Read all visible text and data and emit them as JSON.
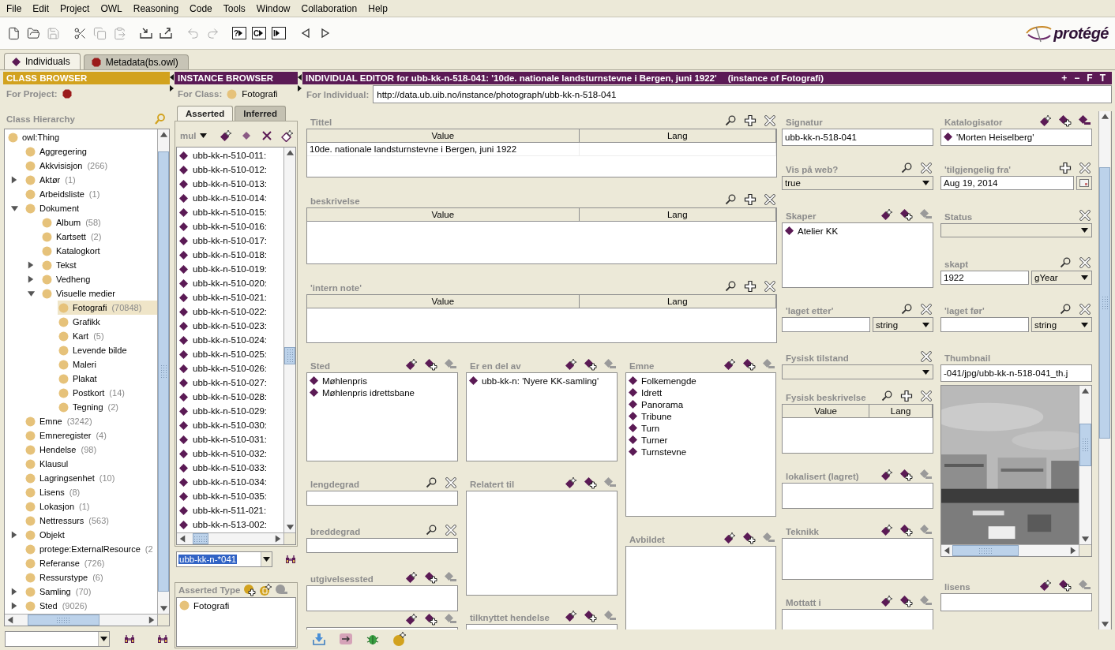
{
  "menu": [
    "File",
    "Edit",
    "Project",
    "OWL",
    "Reasoning",
    "Code",
    "Tools",
    "Window",
    "Collaboration",
    "Help"
  ],
  "toolbar": [
    [
      {
        "kind": "new",
        "disabled": false
      },
      {
        "kind": "open",
        "disabled": false
      },
      {
        "kind": "save",
        "disabled": true
      }
    ],
    [
      {
        "kind": "cut",
        "disabled": false
      },
      {
        "kind": "copy",
        "disabled": true
      },
      {
        "kind": "paste",
        "disabled": true
      }
    ],
    [
      {
        "kind": "import",
        "disabled": false
      },
      {
        "kind": "export",
        "disabled": false
      }
    ],
    [
      {
        "kind": "undo",
        "disabled": true
      },
      {
        "kind": "redo",
        "disabled": true
      }
    ],
    [
      {
        "kind": "query",
        "label": "?",
        "disabled": false
      },
      {
        "kind": "query",
        "label": "C",
        "disabled": false
      },
      {
        "kind": "query",
        "label": "I",
        "disabled": false
      }
    ],
    [
      {
        "kind": "back",
        "disabled": false
      },
      {
        "kind": "forward",
        "disabled": false
      }
    ]
  ],
  "logo": "protégé",
  "tabs": [
    {
      "label": "Individuals",
      "kind": "individual",
      "selected": true
    },
    {
      "label": "Metadata(bs.owl)",
      "kind": "ontology",
      "selected": false
    }
  ],
  "class_browser": {
    "title": "CLASS BROWSER",
    "project_label": "For Project:",
    "hierarchy_label": "Class Hierarchy",
    "tree": [
      {
        "name": "owl:Thing",
        "selected": false,
        "children": [
          {
            "name": "Aggregering",
            "selected": false
          },
          {
            "name": "Akkvisisjon",
            "count": "(266)",
            "selected": false
          },
          {
            "name": "Aktør",
            "count": "(1)",
            "selected": false,
            "expanded": false
          },
          {
            "name": "Arbeidsliste",
            "count": "(1)",
            "selected": false
          },
          {
            "name": "Dokument",
            "selected": false,
            "expanded": true,
            "children": [
              {
                "name": "Album",
                "count": "(58)",
                "selected": false
              },
              {
                "name": "Kartsett",
                "count": "(2)",
                "selected": false
              },
              {
                "name": "Katalogkort",
                "selected": false
              },
              {
                "name": "Tekst",
                "selected": false,
                "expanded": false
              },
              {
                "name": "Vedheng",
                "selected": false,
                "expanded": false
              },
              {
                "name": "Visuelle medier",
                "selected": false,
                "expanded": true,
                "children": [
                  {
                    "name": "Fotografi",
                    "count": "(70848)",
                    "selected": true
                  },
                  {
                    "name": "Grafikk",
                    "selected": false
                  },
                  {
                    "name": "Kart",
                    "count": "(5)",
                    "selected": false
                  },
                  {
                    "name": "Levende bilde",
                    "selected": false
                  },
                  {
                    "name": "Maleri",
                    "selected": false
                  },
                  {
                    "name": "Plakat",
                    "selected": false
                  },
                  {
                    "name": "Postkort",
                    "count": "(14)",
                    "selected": false
                  },
                  {
                    "name": "Tegning",
                    "count": "(2)",
                    "selected": false
                  }
                ]
              }
            ]
          },
          {
            "name": "Emne",
            "count": "(3242)",
            "selected": false
          },
          {
            "name": "Emneregister",
            "count": "(4)",
            "selected": false
          },
          {
            "name": "Hendelse",
            "count": "(98)",
            "selected": false
          },
          {
            "name": "Klausul",
            "selected": false
          },
          {
            "name": "Lagringsenhet",
            "count": "(10)",
            "selected": false
          },
          {
            "name": "Lisens",
            "count": "(8)",
            "selected": false
          },
          {
            "name": "Lokasjon",
            "count": "(1)",
            "selected": false
          },
          {
            "name": "Nettressurs",
            "count": "(563)",
            "selected": false
          },
          {
            "name": "Objekt",
            "selected": false,
            "expanded": false
          },
          {
            "name": "protege:ExternalResource",
            "count": "(2",
            "selected": false
          },
          {
            "name": "Referanse",
            "count": "(726)",
            "selected": false
          },
          {
            "name": "Ressurstype",
            "count": "(6)",
            "selected": false
          },
          {
            "name": "Samling",
            "count": "(70)",
            "selected": false,
            "expanded": false
          },
          {
            "name": "Sted",
            "count": "(9026)",
            "selected": false,
            "expanded": false
          }
        ]
      }
    ]
  },
  "instance_browser": {
    "title": "INSTANCE BROWSER",
    "class_label": "For Class:",
    "class_name": "Fotografi",
    "tabs": [
      {
        "label": "Asserted",
        "selected": true
      },
      {
        "label": "Inferred",
        "selected": false
      }
    ],
    "filter": "mul",
    "tools": [
      {
        "kind": "create"
      },
      {
        "kind": "copy"
      },
      {
        "kind": "delete"
      },
      {
        "kind": "edit"
      }
    ],
    "instances": [
      {
        "name": "ubb-kk-n-510-011:",
        "selected": false
      },
      {
        "name": "ubb-kk-n-510-012:",
        "selected": false
      },
      {
        "name": "ubb-kk-n-510-013:",
        "selected": false
      },
      {
        "name": "ubb-kk-n-510-014:",
        "selected": false
      },
      {
        "name": "ubb-kk-n-510-015:",
        "selected": false
      },
      {
        "name": "ubb-kk-n-510-016:",
        "selected": false
      },
      {
        "name": "ubb-kk-n-510-017:",
        "selected": false
      },
      {
        "name": "ubb-kk-n-510-018:",
        "selected": false
      },
      {
        "name": "ubb-kk-n-510-019:",
        "selected": false
      },
      {
        "name": "ubb-kk-n-510-020:",
        "selected": false
      },
      {
        "name": "ubb-kk-n-510-021:",
        "selected": false
      },
      {
        "name": "ubb-kk-n-510-022:",
        "selected": false
      },
      {
        "name": "ubb-kk-n-510-023:",
        "selected": false
      },
      {
        "name": "ubb-kk-n-510-024:",
        "selected": false
      },
      {
        "name": "ubb-kk-n-510-025:",
        "selected": false
      },
      {
        "name": "ubb-kk-n-510-026:",
        "selected": false
      },
      {
        "name": "ubb-kk-n-510-027:",
        "selected": false
      },
      {
        "name": "ubb-kk-n-510-028:",
        "selected": false
      },
      {
        "name": "ubb-kk-n-510-029:",
        "selected": false
      },
      {
        "name": "ubb-kk-n-510-030:",
        "selected": false
      },
      {
        "name": "ubb-kk-n-510-031:",
        "selected": false
      },
      {
        "name": "ubb-kk-n-510-032:",
        "selected": false
      },
      {
        "name": "ubb-kk-n-510-033:",
        "selected": false
      },
      {
        "name": "ubb-kk-n-510-034:",
        "selected": false
      },
      {
        "name": "ubb-kk-n-510-035:",
        "selected": false
      },
      {
        "name": "ubb-kk-n-511-021:",
        "selected": false
      },
      {
        "name": "ubb-kk-n-513-002:",
        "selected": false
      }
    ],
    "search": "ubb-kk-n-*041",
    "types_label": "Asserted Type",
    "types_tools": [
      {
        "kind": "add_class"
      },
      {
        "kind": "create_class"
      },
      {
        "kind": "remove_class"
      }
    ],
    "types": [
      "Fotografi"
    ]
  },
  "editor": {
    "title": "INDIVIDUAL EDITOR for ubb-kk-n-518-041: '10de. nationale landsturnstevne i Bergen, juni 1922'",
    "subtitle": "(instance of Fotografi)",
    "header_buttons": [
      "+",
      "−",
      "F",
      "T"
    ],
    "individual_label": "For Individual:",
    "uri": "http://data.ub.uib.no/instance/photograph/ubb-kk-n-518-041",
    "left": {
      "top": [
        {
          "label": "Tittel",
          "kind": "table",
          "tools": [
            {
              "kind": "search"
            },
            {
              "kind": "add"
            },
            {
              "kind": "delete"
            }
          ],
          "columns": [
            "Value",
            "Lang"
          ],
          "rows": [
            {
              "value": "10de. nationale landsturnstevne i Bergen, juni 1922"
            }
          ]
        },
        {
          "label": "beskrivelse",
          "kind": "table",
          "tools": [
            {
              "kind": "search"
            },
            {
              "kind": "add"
            },
            {
              "kind": "delete"
            }
          ],
          "columns": [
            "Value",
            "Lang"
          ]
        },
        {
          "label": "'intern note'",
          "kind": "table",
          "tools": [
            {
              "kind": "search"
            },
            {
              "kind": "add"
            },
            {
              "kind": "delete"
            }
          ],
          "columns": [
            "Value",
            "Lang"
          ]
        }
      ],
      "columns": [
        [
          {
            "label": "Sted",
            "kind": "list",
            "tools": [
              {
                "kind": "create_instance"
              },
              {
                "kind": "add_instance"
              },
              {
                "kind": "remove_instance"
              }
            ],
            "can_remove": false,
            "items": [
              "Møhlenpris",
              "Møhlenpris idrettsbane"
            ]
          },
          {
            "label": "lengdegrad",
            "kind": "field",
            "tools": [
              {
                "kind": "search"
              },
              {
                "kind": "delete"
              }
            ]
          },
          {
            "label": "breddegrad",
            "kind": "field",
            "tools": [
              {
                "kind": "search"
              },
              {
                "kind": "delete"
              }
            ]
          },
          {
            "label": "utgivelsessted",
            "kind": "list",
            "tools": [
              {
                "kind": "create_instance"
              },
              {
                "kind": "add_instance"
              },
              {
                "kind": "remove_instance"
              }
            ],
            "can_remove": false
          },
          {
            "kind": "list",
            "tools": [
              {
                "kind": "create_instance"
              },
              {
                "kind": "add_instance"
              },
              {
                "kind": "remove_instance"
              }
            ],
            "can_remove": false
          }
        ],
        [
          {
            "label": "Er en del av",
            "kind": "list",
            "tools": [
              {
                "kind": "create_instance"
              },
              {
                "kind": "add_instance"
              },
              {
                "kind": "remove_instance"
              }
            ],
            "can_remove": false,
            "items": [
              "ubb-kk-n: 'Nyere KK-samling'"
            ]
          },
          {
            "label": "Relatert til",
            "kind": "list",
            "tools": [
              {
                "kind": "create_instance"
              },
              {
                "kind": "add_instance"
              },
              {
                "kind": "remove_instance"
              }
            ],
            "can_remove": false
          },
          {
            "label": "tilknyttet hendelse",
            "kind": "list",
            "tools": [
              {
                "kind": "create_instance"
              },
              {
                "kind": "add_instance"
              },
              {
                "kind": "remove_instance"
              }
            ],
            "can_remove": false
          }
        ],
        [
          {
            "label": "Emne",
            "kind": "list",
            "tools": [
              {
                "kind": "create_instance"
              },
              {
                "kind": "add_instance"
              },
              {
                "kind": "remove_instance"
              }
            ],
            "can_remove": false,
            "items": [
              "Folkemengde",
              "Idrett",
              "Panorama",
              "Tribune",
              "Turn",
              "Turner",
              "Turnstevne"
            ]
          },
          {
            "label": "Avbildet",
            "kind": "list",
            "tools": [
              {
                "kind": "create_instance"
              },
              {
                "kind": "add_instance"
              },
              {
                "kind": "remove_instance"
              }
            ],
            "can_remove": false
          }
        ]
      ]
    },
    "right": [
      [
        {
          "label": "Signatur",
          "kind": "field",
          "value": "ubb-kk-n-518-041"
        },
        {
          "label": "Vis på web?",
          "kind": "select",
          "value": "true",
          "tools": [
            {
              "kind": "search"
            },
            {
              "kind": "delete"
            }
          ]
        },
        {
          "label": "Skaper",
          "kind": "list",
          "tools": [
            {
              "kind": "create_instance"
            },
            {
              "kind": "add_instance"
            },
            {
              "kind": "remove_instance"
            }
          ],
          "can_remove": false,
          "items": [
            "Atelier KK"
          ]
        },
        {
          "label": "'laget etter'",
          "kind": "field_type",
          "datatype": "string",
          "tools": [
            {
              "kind": "search"
            },
            {
              "kind": "delete"
            }
          ]
        },
        {
          "label": "Fysisk tilstand",
          "kind": "select",
          "tools": [
            {
              "kind": "delete"
            }
          ]
        },
        {
          "label": "Fysisk beskrivelse",
          "kind": "table",
          "tools": [
            {
              "kind": "search"
            },
            {
              "kind": "add"
            },
            {
              "kind": "delete"
            }
          ],
          "columns": [
            "Value",
            "Lang"
          ]
        },
        {
          "label": "lokalisert (lagret)",
          "kind": "list",
          "tools": [
            {
              "kind": "create_instance"
            },
            {
              "kind": "add_instance"
            },
            {
              "kind": "remove_instance"
            }
          ],
          "can_remove": false
        },
        {
          "label": "Teknikk",
          "kind": "list",
          "tools": [
            {
              "kind": "create_instance"
            },
            {
              "kind": "add_instance"
            },
            {
              "kind": "remove_instance"
            }
          ],
          "can_remove": false
        },
        {
          "label": "Mottatt i",
          "kind": "list",
          "tools": [
            {
              "kind": "create_instance"
            },
            {
              "kind": "add_instance"
            },
            {
              "kind": "remove_instance"
            }
          ],
          "can_remove": false
        }
      ],
      [
        {
          "label": "Katalogisator",
          "kind": "list",
          "tools": [
            {
              "kind": "create_instance"
            },
            {
              "kind": "add_instance"
            },
            {
              "kind": "remove_instance"
            }
          ],
          "can_remove": true,
          "items": [
            "'Morten Heiselberg'"
          ]
        },
        {
          "label": "'tilgjengelig fra'",
          "kind": "date",
          "value": "Aug 19, 2014",
          "tools": [
            {
              "kind": "add"
            },
            {
              "kind": "delete"
            }
          ]
        },
        {
          "label": "Status",
          "kind": "select",
          "tools": [
            {
              "kind": "delete"
            }
          ]
        },
        {
          "label": "skapt",
          "kind": "field_type",
          "value": "1922",
          "datatype": "gYear",
          "tools": [
            {
              "kind": "search"
            },
            {
              "kind": "delete"
            }
          ]
        },
        {
          "label": "'laget før'",
          "kind": "field_type",
          "datatype": "string",
          "tools": [
            {
              "kind": "search"
            },
            {
              "kind": "delete"
            }
          ]
        },
        {
          "label": "Thumbnail",
          "kind": "thumbnail",
          "value": "-041/jpg/ubb-kk-n-518-041_th.j"
        },
        {
          "label": "lisens",
          "kind": "list",
          "tools": [
            {
              "kind": "create_instance"
            },
            {
              "kind": "add_instance"
            },
            {
              "kind": "remove_instance"
            }
          ],
          "can_remove": false
        }
      ]
    ],
    "bottom_tools": [
      {
        "kind": "import"
      },
      {
        "kind": "navigate"
      },
      {
        "kind": "bug"
      },
      {
        "kind": "create_class"
      }
    ]
  }
}
